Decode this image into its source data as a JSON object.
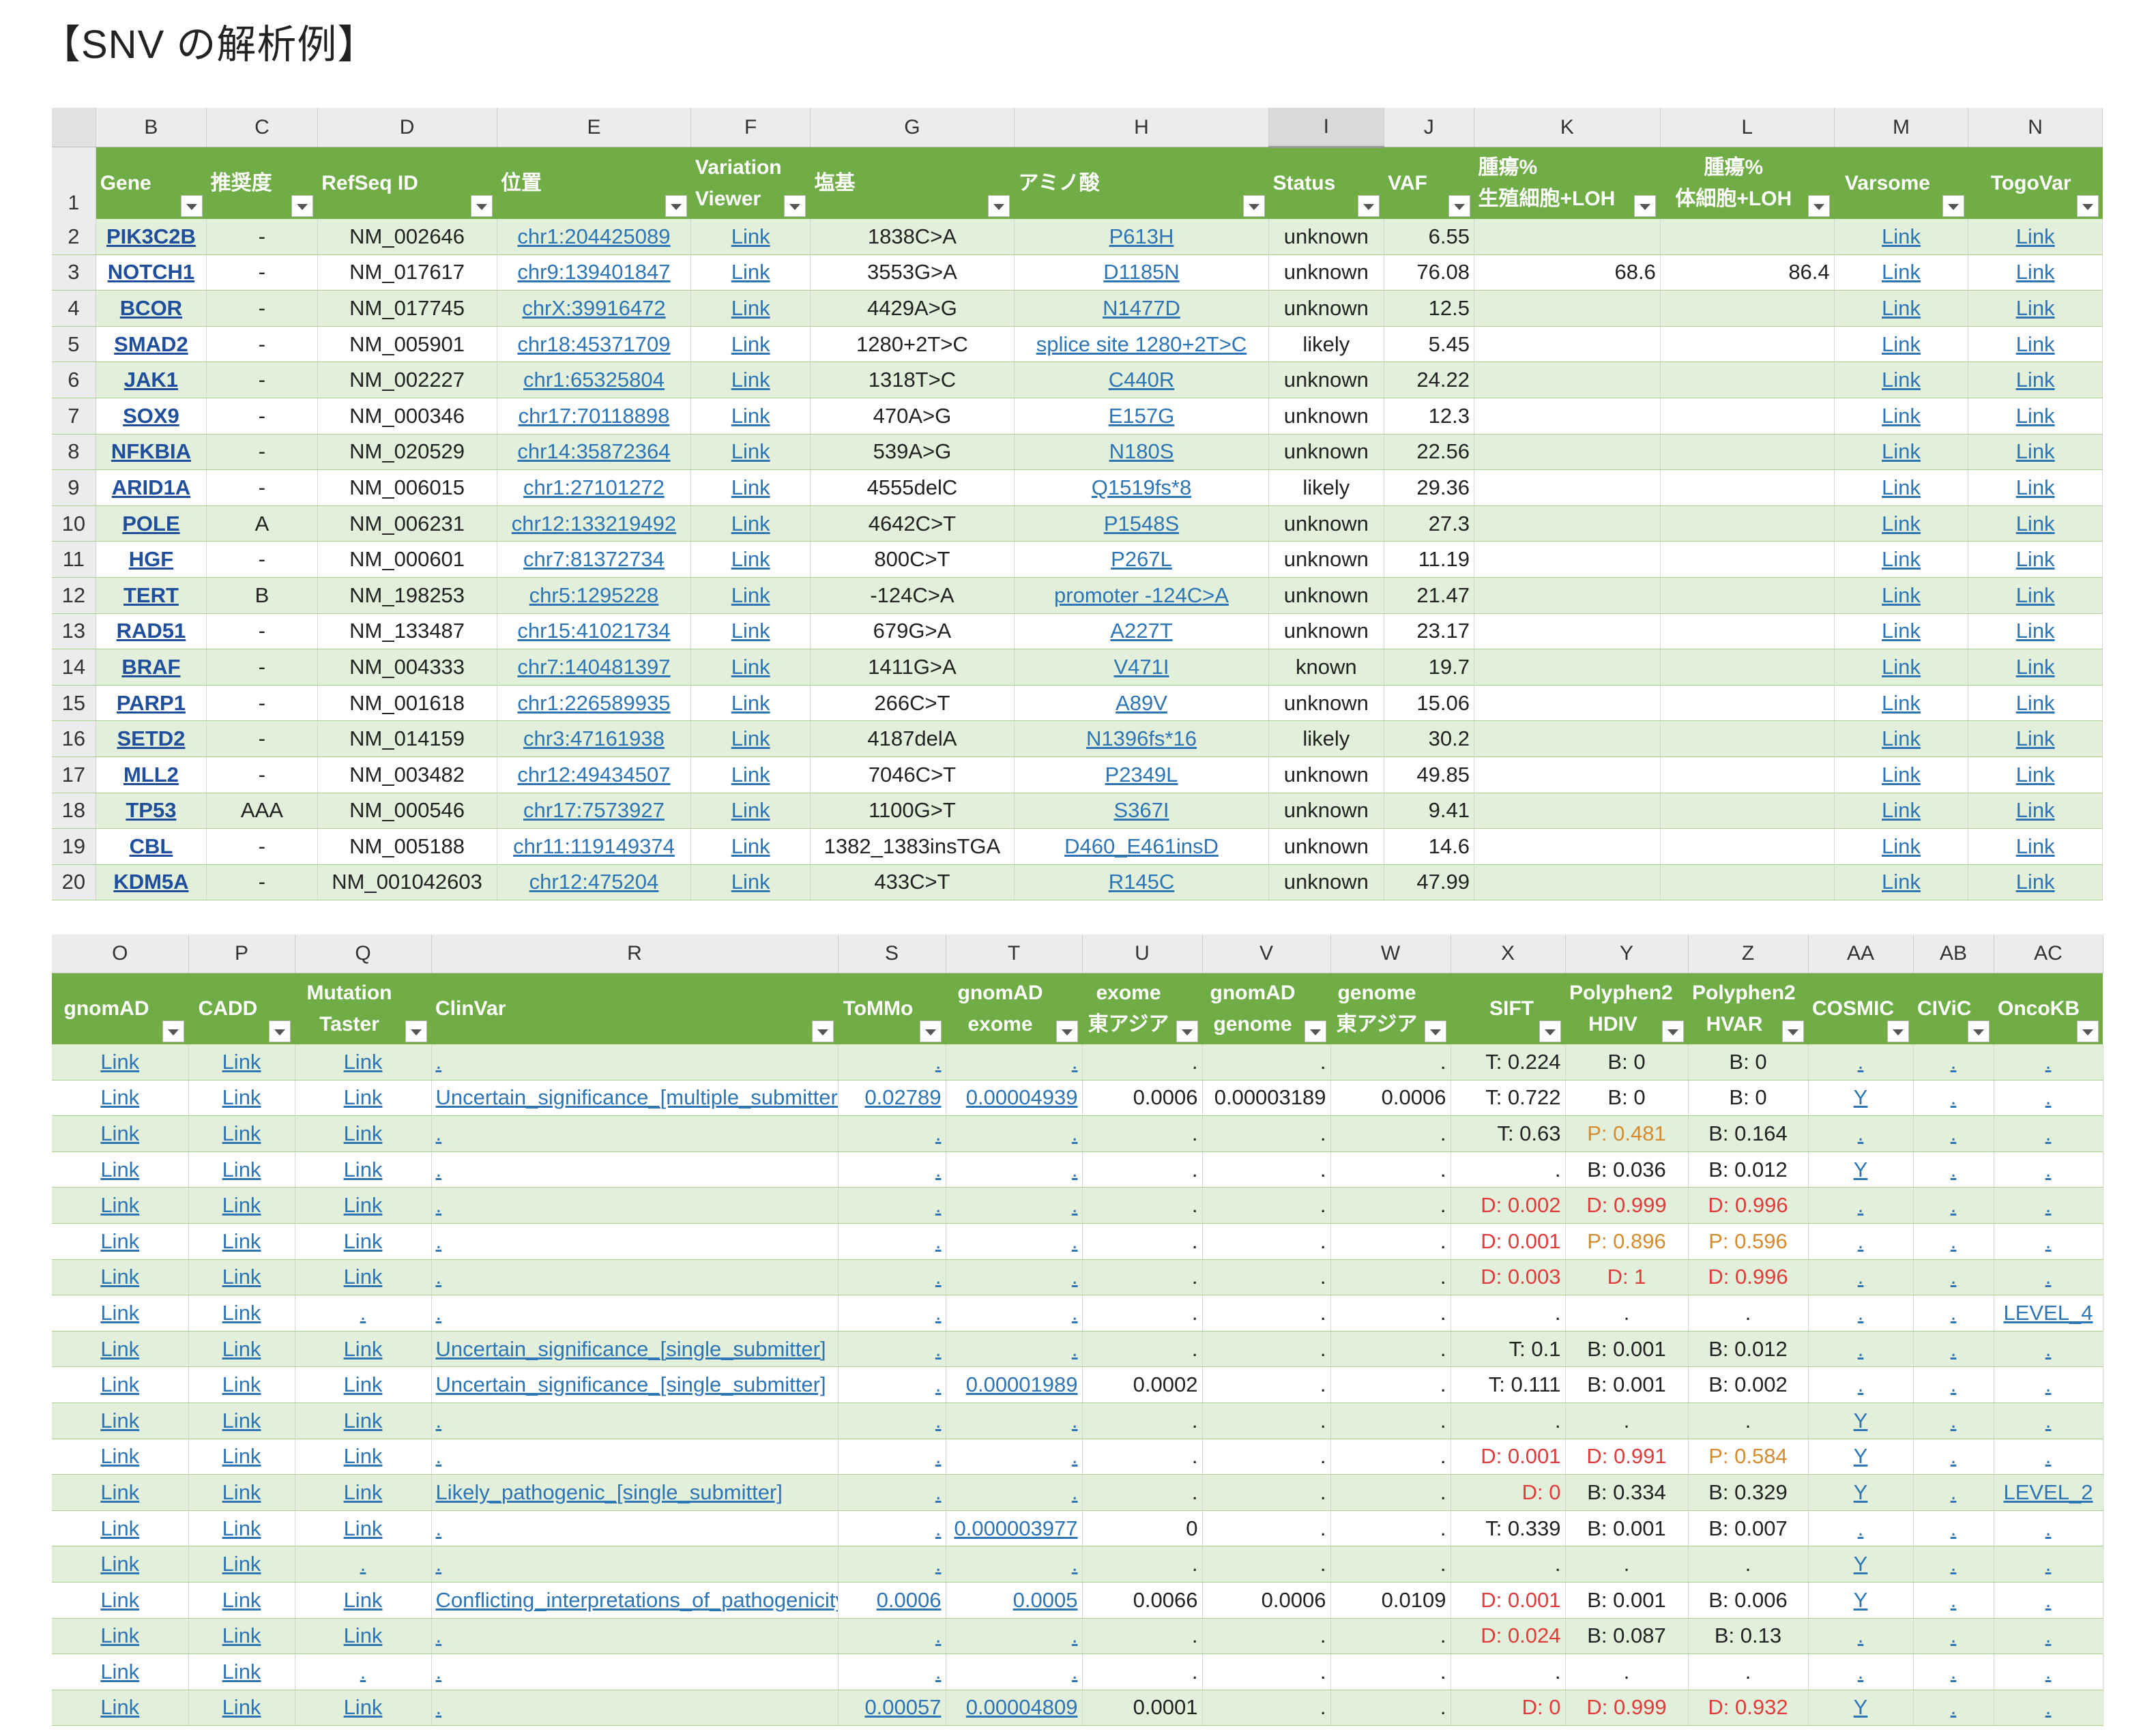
{
  "title": "【SNV の解析例】",
  "colors": {
    "header_green": "#70ad47",
    "band_green": "#e2efda",
    "link_blue": "#2e75b6",
    "red": "#e23b3b",
    "orange": "#d68b2e"
  },
  "table1": {
    "col_letters": [
      "B",
      "C",
      "D",
      "E",
      "F",
      "G",
      "H",
      "I",
      "J",
      "K",
      "L",
      "M",
      "N"
    ],
    "headers": [
      {
        "l1": "",
        "l2": "Gene"
      },
      {
        "l1": "",
        "l2": "推奨度"
      },
      {
        "l1": "",
        "l2": "RefSeq ID"
      },
      {
        "l1": "",
        "l2": "位置"
      },
      {
        "l1": "Variation",
        "l2": "Viewer"
      },
      {
        "l1": "",
        "l2": "塩基"
      },
      {
        "l1": "",
        "l2": "アミノ酸"
      },
      {
        "l1": "",
        "l2": "Status"
      },
      {
        "l1": "",
        "l2": "VAF"
      },
      {
        "l1": "腫瘍%",
        "l2": "生殖細胞+LOH"
      },
      {
        "l1": "腫瘍%",
        "l2": "体細胞+LOH"
      },
      {
        "l1": "",
        "l2": "Varsome"
      },
      {
        "l1": "",
        "l2": "TogoVar"
      }
    ],
    "rows": [
      {
        "n": "2",
        "gene": "PIK3C2B",
        "rec": "-",
        "refseq": "NM_002646",
        "pos": "chr1:204425089",
        "viewer": "Link",
        "base": "1838C>A",
        "aa": "P613H",
        "status": "unknown",
        "vaf": "6.55",
        "germ": "",
        "som": "",
        "varsome": "Link",
        "togovar": "Link"
      },
      {
        "n": "3",
        "gene": "NOTCH1",
        "rec": "-",
        "refseq": "NM_017617",
        "pos": "chr9:139401847",
        "viewer": "Link",
        "base": "3553G>A",
        "aa": "D1185N",
        "status": "unknown",
        "vaf": "76.08",
        "germ": "68.6",
        "som": "86.4",
        "varsome": "Link",
        "togovar": "Link"
      },
      {
        "n": "4",
        "gene": "BCOR",
        "rec": "-",
        "refseq": "NM_017745",
        "pos": "chrX:39916472",
        "viewer": "Link",
        "base": "4429A>G",
        "aa": "N1477D",
        "status": "unknown",
        "vaf": "12.5",
        "germ": "",
        "som": "",
        "varsome": "Link",
        "togovar": "Link"
      },
      {
        "n": "5",
        "gene": "SMAD2",
        "rec": "-",
        "refseq": "NM_005901",
        "pos": "chr18:45371709",
        "viewer": "Link",
        "base": "1280+2T>C",
        "aa": "splice site 1280+2T>C",
        "status": "likely",
        "vaf": "5.45",
        "germ": "",
        "som": "",
        "varsome": "Link",
        "togovar": "Link"
      },
      {
        "n": "6",
        "gene": "JAK1",
        "rec": "-",
        "refseq": "NM_002227",
        "pos": "chr1:65325804",
        "viewer": "Link",
        "base": "1318T>C",
        "aa": "C440R",
        "status": "unknown",
        "vaf": "24.22",
        "germ": "",
        "som": "",
        "varsome": "Link",
        "togovar": "Link"
      },
      {
        "n": "7",
        "gene": "SOX9",
        "rec": "-",
        "refseq": "NM_000346",
        "pos": "chr17:70118898",
        "viewer": "Link",
        "base": "470A>G",
        "aa": "E157G",
        "status": "unknown",
        "vaf": "12.3",
        "germ": "",
        "som": "",
        "varsome": "Link",
        "togovar": "Link"
      },
      {
        "n": "8",
        "gene": "NFKBIA",
        "rec": "-",
        "refseq": "NM_020529",
        "pos": "chr14:35872364",
        "viewer": "Link",
        "base": "539A>G",
        "aa": "N180S",
        "status": "unknown",
        "vaf": "22.56",
        "germ": "",
        "som": "",
        "varsome": "Link",
        "togovar": "Link"
      },
      {
        "n": "9",
        "gene": "ARID1A",
        "rec": "-",
        "refseq": "NM_006015",
        "pos": "chr1:27101272",
        "viewer": "Link",
        "base": "4555delC",
        "aa": "Q1519fs*8",
        "status": "likely",
        "vaf": "29.36",
        "germ": "",
        "som": "",
        "varsome": "Link",
        "togovar": "Link"
      },
      {
        "n": "10",
        "gene": "POLE",
        "rec": "A",
        "refseq": "NM_006231",
        "pos": "chr12:133219492",
        "viewer": "Link",
        "base": "4642C>T",
        "aa": "P1548S",
        "status": "unknown",
        "vaf": "27.3",
        "germ": "",
        "som": "",
        "varsome": "Link",
        "togovar": "Link"
      },
      {
        "n": "11",
        "gene": "HGF",
        "rec": "-",
        "refseq": "NM_000601",
        "pos": "chr7:81372734",
        "viewer": "Link",
        "base": "800C>T",
        "aa": "P267L",
        "status": "unknown",
        "vaf": "11.19",
        "germ": "",
        "som": "",
        "varsome": "Link",
        "togovar": "Link"
      },
      {
        "n": "12",
        "gene": "TERT",
        "rec": "B",
        "refseq": "NM_198253",
        "pos": "chr5:1295228",
        "viewer": "Link",
        "base": "-124C>A",
        "aa": "promoter -124C>A",
        "status": "unknown",
        "vaf": "21.47",
        "germ": "",
        "som": "",
        "varsome": "Link",
        "togovar": "Link"
      },
      {
        "n": "13",
        "gene": "RAD51",
        "rec": "-",
        "refseq": "NM_133487",
        "pos": "chr15:41021734",
        "viewer": "Link",
        "base": "679G>A",
        "aa": "A227T",
        "status": "unknown",
        "vaf": "23.17",
        "germ": "",
        "som": "",
        "varsome": "Link",
        "togovar": "Link"
      },
      {
        "n": "14",
        "gene": "BRAF",
        "rec": "-",
        "refseq": "NM_004333",
        "pos": "chr7:140481397",
        "viewer": "Link",
        "base": "1411G>A",
        "aa": "V471I",
        "status": "known",
        "vaf": "19.7",
        "germ": "",
        "som": "",
        "varsome": "Link",
        "togovar": "Link"
      },
      {
        "n": "15",
        "gene": "PARP1",
        "rec": "-",
        "refseq": "NM_001618",
        "pos": "chr1:226589935",
        "viewer": "Link",
        "base": "266C>T",
        "aa": "A89V",
        "status": "unknown",
        "vaf": "15.06",
        "germ": "",
        "som": "",
        "varsome": "Link",
        "togovar": "Link"
      },
      {
        "n": "16",
        "gene": "SETD2",
        "rec": "-",
        "refseq": "NM_014159",
        "pos": "chr3:47161938",
        "viewer": "Link",
        "base": "4187delA",
        "aa": "N1396fs*16",
        "status": "likely",
        "vaf": "30.2",
        "germ": "",
        "som": "",
        "varsome": "Link",
        "togovar": "Link"
      },
      {
        "n": "17",
        "gene": "MLL2",
        "rec": "-",
        "refseq": "NM_003482",
        "pos": "chr12:49434507",
        "viewer": "Link",
        "base": "7046C>T",
        "aa": "P2349L",
        "status": "unknown",
        "vaf": "49.85",
        "germ": "",
        "som": "",
        "varsome": "Link",
        "togovar": "Link"
      },
      {
        "n": "18",
        "gene": "TP53",
        "rec": "AAA",
        "refseq": "NM_000546",
        "pos": "chr17:7573927",
        "viewer": "Link",
        "base": "1100G>T",
        "aa": "S367I",
        "status": "unknown",
        "vaf": "9.41",
        "germ": "",
        "som": "",
        "varsome": "Link",
        "togovar": "Link"
      },
      {
        "n": "19",
        "gene": "CBL",
        "rec": "-",
        "refseq": "NM_005188",
        "pos": "chr11:119149374",
        "viewer": "Link",
        "base": "1382_1383insTGA",
        "aa": "D460_E461insD",
        "status": "unknown",
        "vaf": "14.6",
        "germ": "",
        "som": "",
        "varsome": "Link",
        "togovar": "Link"
      },
      {
        "n": "20",
        "gene": "KDM5A",
        "rec": "-",
        "refseq": "NM_001042603",
        "pos": "chr12:475204",
        "viewer": "Link",
        "base": "433C>T",
        "aa": "R145C",
        "status": "unknown",
        "vaf": "47.99",
        "germ": "",
        "som": "",
        "varsome": "Link",
        "togovar": "Link"
      }
    ]
  },
  "table2": {
    "col_letters": [
      "O",
      "P",
      "Q",
      "R",
      "S",
      "T",
      "U",
      "V",
      "W",
      "X",
      "Y",
      "Z",
      "AA",
      "AB",
      "AC"
    ],
    "headers": [
      {
        "l1": "",
        "l2": "gnomAD"
      },
      {
        "l1": "",
        "l2": "CADD"
      },
      {
        "l1": "Mutation",
        "l2": "Taster"
      },
      {
        "l1": "",
        "l2": "ClinVar"
      },
      {
        "l1": "",
        "l2": "ToMMo"
      },
      {
        "l1": "gnomAD",
        "l2": "exome"
      },
      {
        "l1": "exome",
        "l2": "東アジア"
      },
      {
        "l1": "gnomAD",
        "l2": "genome"
      },
      {
        "l1": "genome",
        "l2": "東アジア"
      },
      {
        "l1": "",
        "l2": "SIFT"
      },
      {
        "l1": "Polyphen2",
        "l2": "HDIV"
      },
      {
        "l1": "Polyphen2",
        "l2": "HVAR"
      },
      {
        "l1": "",
        "l2": "COSMIC"
      },
      {
        "l1": "",
        "l2": "CIViC"
      },
      {
        "l1": "",
        "l2": "OncoKB"
      }
    ],
    "rows": [
      {
        "gnomad": "Link",
        "cadd": "Link",
        "mt": "Link",
        "clinvar": ".",
        "tommo": ".",
        "gex": ".",
        "exea": ".",
        "ggen": ".",
        "genea": ".",
        "sift": "T: 0.224",
        "hdiv": "B: 0",
        "hvar": "B: 0",
        "cosmic": ".",
        "civic": ".",
        "oncokb": "."
      },
      {
        "gnomad": "Link",
        "cadd": "Link",
        "mt": "Link",
        "clinvar": "Uncertain_significance_[multiple_submitters]",
        "tommo": "0.02789",
        "gex": "0.00004939",
        "exea": "0.0006",
        "ggen": "0.00003189",
        "genea": "0.0006",
        "sift": "T: 0.722",
        "hdiv": "B: 0",
        "hvar": "B: 0",
        "cosmic": "Y",
        "civic": ".",
        "oncokb": "."
      },
      {
        "gnomad": "Link",
        "cadd": "Link",
        "mt": "Link",
        "clinvar": ".",
        "tommo": ".",
        "gex": ".",
        "exea": ".",
        "ggen": ".",
        "genea": ".",
        "sift": "T: 0.63",
        "hdiv": "P: 0.481",
        "hvar": "B: 0.164",
        "cosmic": ".",
        "civic": ".",
        "oncokb": "."
      },
      {
        "gnomad": "Link",
        "cadd": "Link",
        "mt": "Link",
        "clinvar": ".",
        "tommo": ".",
        "gex": ".",
        "exea": ".",
        "ggen": ".",
        "genea": ".",
        "sift": ".",
        "hdiv": "B: 0.036",
        "hvar": "B: 0.012",
        "cosmic": "Y",
        "civic": ".",
        "oncokb": "."
      },
      {
        "gnomad": "Link",
        "cadd": "Link",
        "mt": "Link",
        "clinvar": ".",
        "tommo": ".",
        "gex": ".",
        "exea": ".",
        "ggen": ".",
        "genea": ".",
        "sift": "D: 0.002",
        "hdiv": "D: 0.999",
        "hvar": "D: 0.996",
        "cosmic": ".",
        "civic": ".",
        "oncokb": "."
      },
      {
        "gnomad": "Link",
        "cadd": "Link",
        "mt": "Link",
        "clinvar": ".",
        "tommo": ".",
        "gex": ".",
        "exea": ".",
        "ggen": ".",
        "genea": ".",
        "sift": "D: 0.001",
        "hdiv": "P: 0.896",
        "hvar": "P: 0.596",
        "cosmic": ".",
        "civic": ".",
        "oncokb": "."
      },
      {
        "gnomad": "Link",
        "cadd": "Link",
        "mt": "Link",
        "clinvar": ".",
        "tommo": ".",
        "gex": ".",
        "exea": ".",
        "ggen": ".",
        "genea": ".",
        "sift": "D: 0.003",
        "hdiv": "D: 1",
        "hvar": "D: 0.996",
        "cosmic": ".",
        "civic": ".",
        "oncokb": "."
      },
      {
        "gnomad": "Link",
        "cadd": "Link",
        "mt": ".",
        "clinvar": ".",
        "tommo": ".",
        "gex": ".",
        "exea": ".",
        "ggen": ".",
        "genea": ".",
        "sift": ".",
        "hdiv": ".",
        "hvar": ".",
        "cosmic": ".",
        "civic": ".",
        "oncokb": "LEVEL_4"
      },
      {
        "gnomad": "Link",
        "cadd": "Link",
        "mt": "Link",
        "clinvar": "Uncertain_significance_[single_submitter]",
        "tommo": ".",
        "gex": ".",
        "exea": ".",
        "ggen": ".",
        "genea": ".",
        "sift": "T: 0.1",
        "hdiv": "B: 0.001",
        "hvar": "B: 0.012",
        "cosmic": ".",
        "civic": ".",
        "oncokb": "."
      },
      {
        "gnomad": "Link",
        "cadd": "Link",
        "mt": "Link",
        "clinvar": "Uncertain_significance_[single_submitter]",
        "tommo": ".",
        "gex": "0.00001989",
        "exea": "0.0002",
        "ggen": ".",
        "genea": ".",
        "sift": "T: 0.111",
        "hdiv": "B: 0.001",
        "hvar": "B: 0.002",
        "cosmic": ".",
        "civic": ".",
        "oncokb": "."
      },
      {
        "gnomad": "Link",
        "cadd": "Link",
        "mt": "Link",
        "clinvar": ".",
        "tommo": ".",
        "gex": ".",
        "exea": ".",
        "ggen": ".",
        "genea": ".",
        "sift": ".",
        "hdiv": ".",
        "hvar": ".",
        "cosmic": "Y",
        "civic": ".",
        "oncokb": "."
      },
      {
        "gnomad": "Link",
        "cadd": "Link",
        "mt": "Link",
        "clinvar": ".",
        "tommo": ".",
        "gex": ".",
        "exea": ".",
        "ggen": ".",
        "genea": ".",
        "sift": "D: 0.001",
        "hdiv": "D: 0.991",
        "hvar": "P: 0.584",
        "cosmic": "Y",
        "civic": ".",
        "oncokb": "."
      },
      {
        "gnomad": "Link",
        "cadd": "Link",
        "mt": "Link",
        "clinvar": "Likely_pathogenic_[single_submitter]",
        "tommo": ".",
        "gex": ".",
        "exea": ".",
        "ggen": ".",
        "genea": ".",
        "sift": "D: 0",
        "hdiv": "B: 0.334",
        "hvar": "B: 0.329",
        "cosmic": "Y",
        "civic": ".",
        "oncokb": "LEVEL_2"
      },
      {
        "gnomad": "Link",
        "cadd": "Link",
        "mt": "Link",
        "clinvar": ".",
        "tommo": ".",
        "gex": "0.000003977",
        "exea": "0",
        "ggen": ".",
        "genea": ".",
        "sift": "T: 0.339",
        "hdiv": "B: 0.001",
        "hvar": "B: 0.007",
        "cosmic": ".",
        "civic": ".",
        "oncokb": "."
      },
      {
        "gnomad": "Link",
        "cadd": "Link",
        "mt": ".",
        "clinvar": ".",
        "tommo": ".",
        "gex": ".",
        "exea": ".",
        "ggen": ".",
        "genea": ".",
        "sift": ".",
        "hdiv": ".",
        "hvar": ".",
        "cosmic": "Y",
        "civic": ".",
        "oncokb": "."
      },
      {
        "gnomad": "Link",
        "cadd": "Link",
        "mt": "Link",
        "clinvar": "Conflicting_interpretations_of_pathogenicity",
        "tommo": "0.0006",
        "gex": "0.0005",
        "exea": "0.0066",
        "ggen": "0.0006",
        "genea": "0.0109",
        "sift": "D: 0.001",
        "hdiv": "B: 0.001",
        "hvar": "B: 0.006",
        "cosmic": "Y",
        "civic": ".",
        "oncokb": "."
      },
      {
        "gnomad": "Link",
        "cadd": "Link",
        "mt": "Link",
        "clinvar": ".",
        "tommo": ".",
        "gex": ".",
        "exea": ".",
        "ggen": ".",
        "genea": ".",
        "sift": "D: 0.024",
        "hdiv": "B: 0.087",
        "hvar": "B: 0.13",
        "cosmic": ".",
        "civic": ".",
        "oncokb": "."
      },
      {
        "gnomad": "Link",
        "cadd": "Link",
        "mt": ".",
        "clinvar": ".",
        "tommo": ".",
        "gex": ".",
        "exea": ".",
        "ggen": ".",
        "genea": ".",
        "sift": ".",
        "hdiv": ".",
        "hvar": ".",
        "cosmic": ".",
        "civic": ".",
        "oncokb": "."
      },
      {
        "gnomad": "Link",
        "cadd": "Link",
        "mt": "Link",
        "clinvar": ".",
        "tommo": "0.00057",
        "gex": "0.00004809",
        "exea": "0.0001",
        "ggen": ".",
        "genea": ".",
        "sift": "D: 0",
        "hdiv": "D: 0.999",
        "hvar": "D: 0.932",
        "cosmic": "Y",
        "civic": ".",
        "oncokb": "."
      }
    ]
  }
}
